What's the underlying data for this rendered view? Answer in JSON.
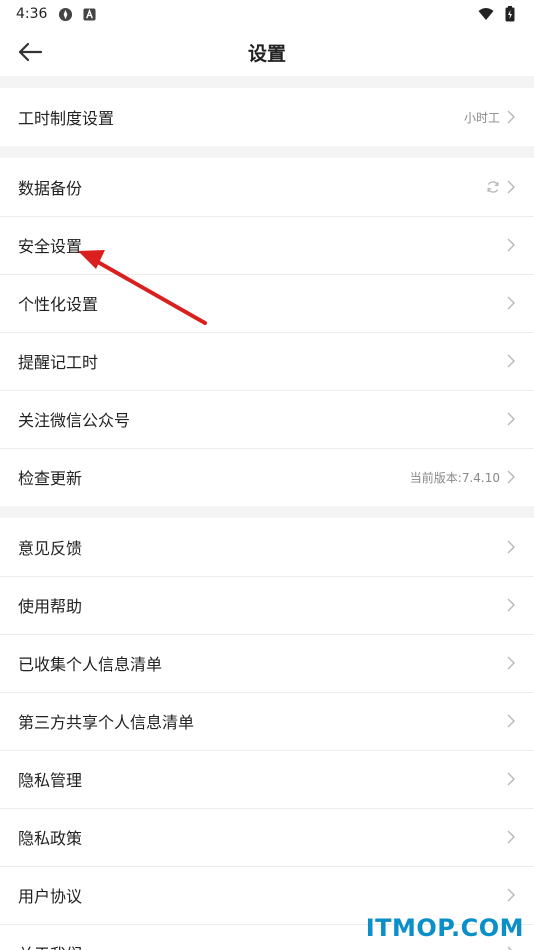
{
  "status": {
    "time": "4:36"
  },
  "header": {
    "title": "设置"
  },
  "groups": [
    {
      "items": [
        {
          "label": "工时制度设置",
          "value": "小时工"
        }
      ]
    },
    {
      "items": [
        {
          "label": "数据备份",
          "value": ""
        },
        {
          "label": "安全设置",
          "value": ""
        },
        {
          "label": "个性化设置",
          "value": ""
        },
        {
          "label": "提醒记工时",
          "value": ""
        },
        {
          "label": "关注微信公众号",
          "value": ""
        },
        {
          "label": "检查更新",
          "value": "当前版本:7.4.10"
        }
      ]
    },
    {
      "items": [
        {
          "label": "意见反馈",
          "value": ""
        },
        {
          "label": "使用帮助",
          "value": ""
        },
        {
          "label": "已收集个人信息清单",
          "value": ""
        },
        {
          "label": "第三方共享个人信息清单",
          "value": ""
        },
        {
          "label": "隐私管理",
          "value": ""
        },
        {
          "label": "隐私政策",
          "value": ""
        },
        {
          "label": "用户协议",
          "value": ""
        },
        {
          "label": "关于我们",
          "value": ""
        }
      ]
    }
  ],
  "watermark": "ITMOP.COM",
  "colors": {
    "annotation_arrow": "#d9201e",
    "watermark": "#0a8fc9"
  }
}
